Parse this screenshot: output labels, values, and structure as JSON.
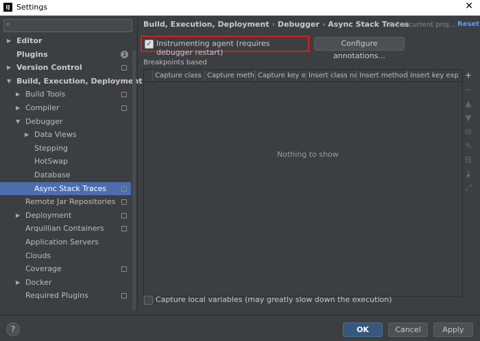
{
  "window": {
    "title": "Settings",
    "app_icon": "IJ",
    "close_glyph": "✕"
  },
  "search": {
    "value": "",
    "placeholder": ""
  },
  "tree": [
    {
      "label": "Editor",
      "indent": 0,
      "arrow": "▶",
      "bold": true,
      "badge": "",
      "proj": false,
      "selected": false
    },
    {
      "label": "Plugins",
      "indent": 0,
      "arrow": "",
      "bold": true,
      "badge": "1",
      "proj": false,
      "selected": false
    },
    {
      "label": "Version Control",
      "indent": 0,
      "arrow": "▶",
      "bold": true,
      "badge": "",
      "proj": true,
      "selected": false
    },
    {
      "label": "Build, Execution, Deployment",
      "indent": 0,
      "arrow": "▼",
      "bold": true,
      "badge": "",
      "proj": false,
      "selected": false
    },
    {
      "label": "Build Tools",
      "indent": 1,
      "arrow": "▶",
      "bold": false,
      "badge": "",
      "proj": true,
      "selected": false
    },
    {
      "label": "Compiler",
      "indent": 1,
      "arrow": "▶",
      "bold": false,
      "badge": "",
      "proj": true,
      "selected": false
    },
    {
      "label": "Debugger",
      "indent": 1,
      "arrow": "▼",
      "bold": false,
      "badge": "",
      "proj": false,
      "selected": false
    },
    {
      "label": "Data Views",
      "indent": 2,
      "arrow": "▶",
      "bold": false,
      "badge": "",
      "proj": false,
      "selected": false
    },
    {
      "label": "Stepping",
      "indent": 2,
      "arrow": "",
      "bold": false,
      "badge": "",
      "proj": false,
      "selected": false
    },
    {
      "label": "HotSwap",
      "indent": 2,
      "arrow": "",
      "bold": false,
      "badge": "",
      "proj": false,
      "selected": false
    },
    {
      "label": "Database",
      "indent": 2,
      "arrow": "",
      "bold": false,
      "badge": "",
      "proj": false,
      "selected": false
    },
    {
      "label": "Async Stack Traces",
      "indent": 2,
      "arrow": "",
      "bold": false,
      "badge": "",
      "proj": true,
      "selected": true
    },
    {
      "label": "Remote Jar Repositories",
      "indent": 1,
      "arrow": "",
      "bold": false,
      "badge": "",
      "proj": true,
      "selected": false
    },
    {
      "label": "Deployment",
      "indent": 1,
      "arrow": "▶",
      "bold": false,
      "badge": "",
      "proj": true,
      "selected": false
    },
    {
      "label": "Arquillian Containers",
      "indent": 1,
      "arrow": "",
      "bold": false,
      "badge": "",
      "proj": true,
      "selected": false
    },
    {
      "label": "Application Servers",
      "indent": 1,
      "arrow": "",
      "bold": false,
      "badge": "",
      "proj": false,
      "selected": false
    },
    {
      "label": "Clouds",
      "indent": 1,
      "arrow": "",
      "bold": false,
      "badge": "",
      "proj": false,
      "selected": false
    },
    {
      "label": "Coverage",
      "indent": 1,
      "arrow": "",
      "bold": false,
      "badge": "",
      "proj": true,
      "selected": false
    },
    {
      "label": "Docker",
      "indent": 1,
      "arrow": "▶",
      "bold": false,
      "badge": "",
      "proj": false,
      "selected": false
    },
    {
      "label": "Required Plugins",
      "indent": 1,
      "arrow": "",
      "bold": false,
      "badge": "",
      "proj": true,
      "selected": false
    }
  ],
  "breadcrumb": {
    "parts": [
      "Build, Execution, Deployment",
      "Debugger",
      "Async Stack Traces"
    ],
    "sep": "›"
  },
  "scope_label": "For current proj...",
  "reset_label": "Reset",
  "agent": {
    "label": "Instrumenting agent (requires debugger restart)",
    "checked": true
  },
  "configure_label": "Configure annotations...",
  "section_title": "Breakpoints based",
  "table": {
    "columns": [
      "Capture class ...",
      "Capture meth...",
      "Capture key e...",
      "Insert class na...",
      "Insert method ...",
      "Insert key exp..."
    ],
    "empty_text": "Nothing to show"
  },
  "toolbar_icons": [
    {
      "name": "add-icon",
      "glyph": "+",
      "state": "on"
    },
    {
      "name": "remove-icon",
      "glyph": "−",
      "state": "off"
    },
    {
      "name": "move-up-icon",
      "glyph": "▲",
      "state": "off"
    },
    {
      "name": "move-down-icon",
      "glyph": "▼",
      "state": "off"
    },
    {
      "name": "copy-icon",
      "glyph": "⧉",
      "state": "off"
    },
    {
      "name": "edit-icon",
      "glyph": "✎",
      "state": "off"
    },
    {
      "name": "toggle-icon",
      "glyph": "⊟",
      "state": "off"
    },
    {
      "name": "import-icon",
      "glyph": "⤓",
      "state": "green"
    },
    {
      "name": "export-icon",
      "glyph": "⤢",
      "state": "off"
    }
  ],
  "capture_local": {
    "label": "Capture local variables (may greatly slow down the execution)",
    "checked": false
  },
  "buttons": {
    "help": "?",
    "ok": "OK",
    "cancel": "Cancel",
    "apply": "Apply"
  }
}
